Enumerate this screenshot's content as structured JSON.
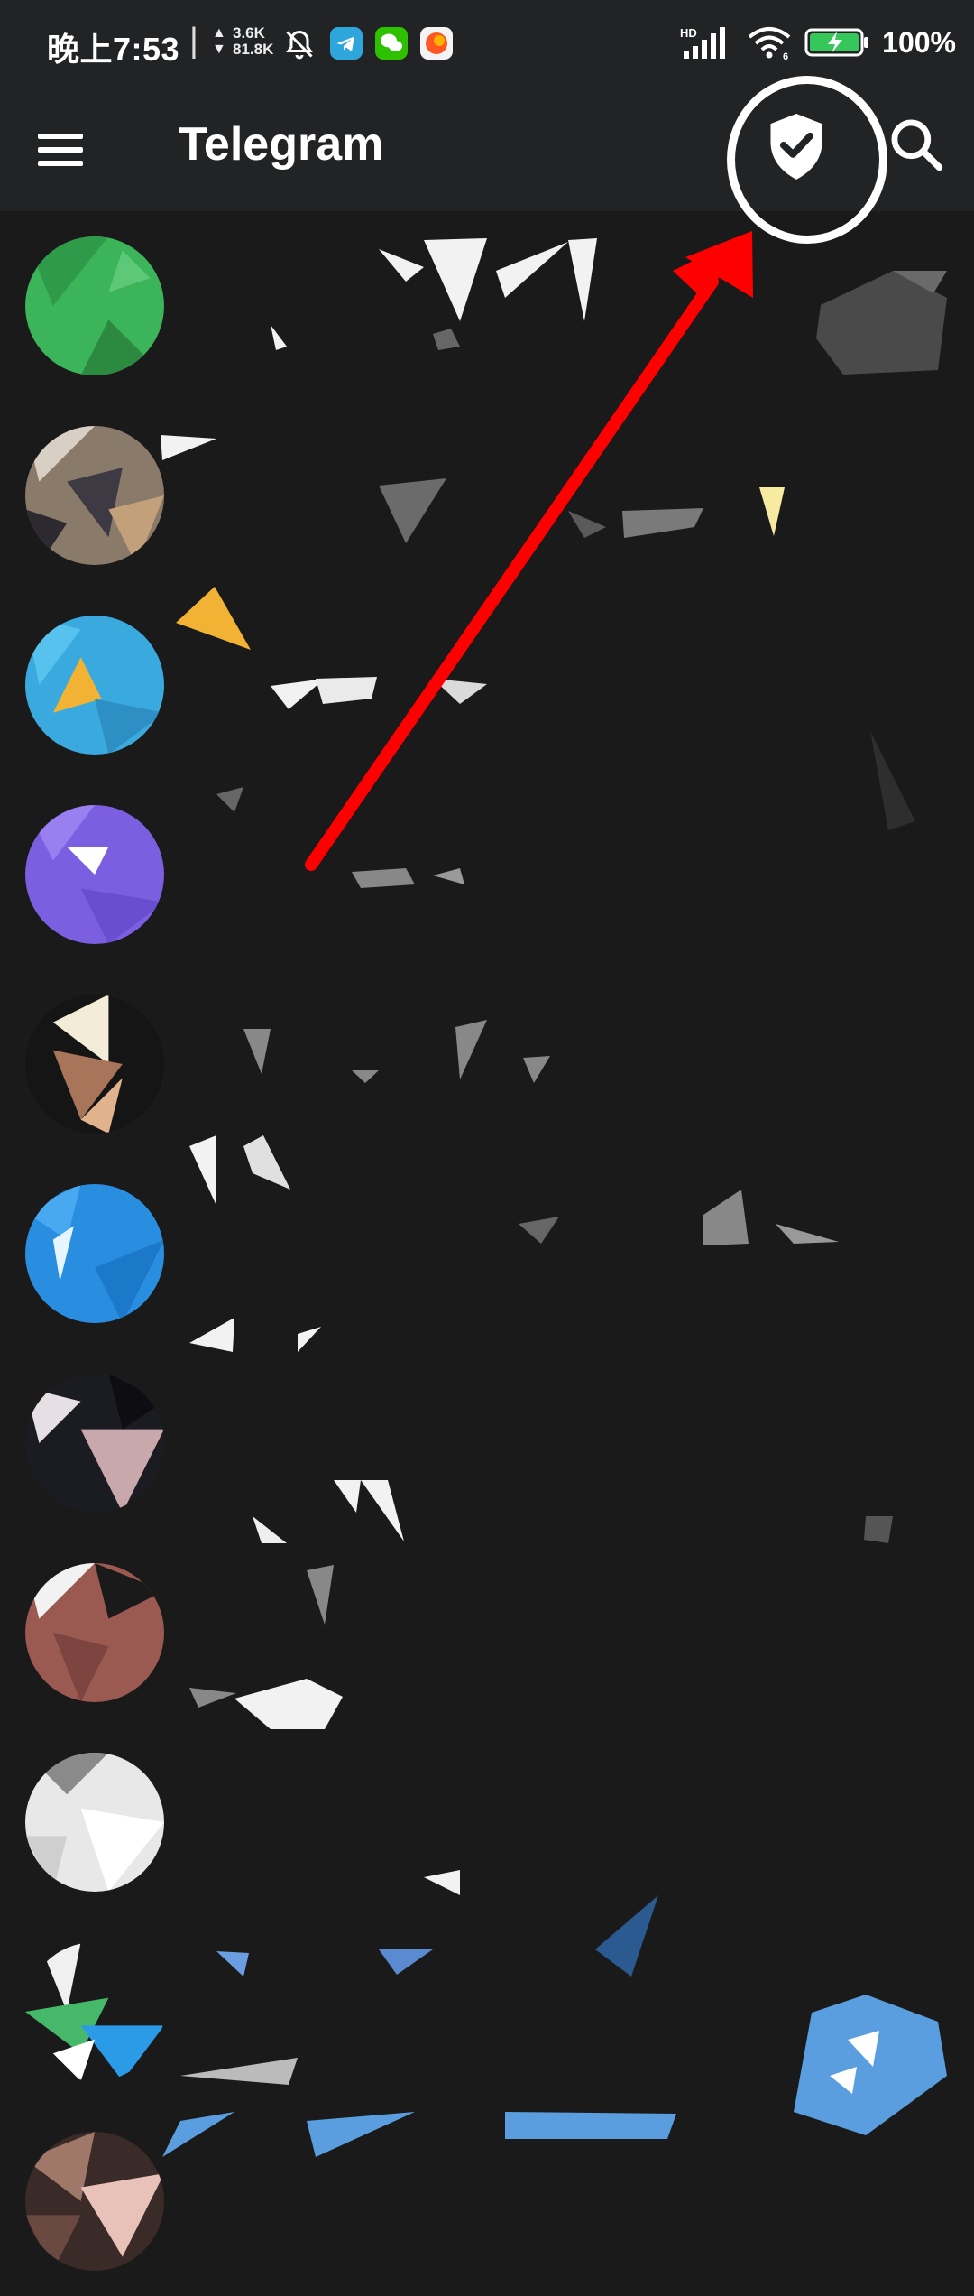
{
  "status_bar": {
    "time": "晚上7:53",
    "separator": "|",
    "upload_speed": "3.6K",
    "download_speed": "81.8K",
    "battery_percent": "100%",
    "hd_label": "HD",
    "wifi_label": "6",
    "icons": [
      "mute-bell-icon",
      "telegram-app-icon",
      "wechat-app-icon",
      "orange-app-icon",
      "signal-icon",
      "wifi-icon",
      "battery-charging-icon"
    ]
  },
  "app_bar": {
    "title": "Telegram",
    "icons": [
      "menu-icon",
      "shield-check-icon",
      "search-icon"
    ]
  },
  "annotation": {
    "arrow_color": "#ff0000",
    "circle_color": "#ffffff"
  },
  "colors": {
    "background": "#1a1a1a",
    "app_bar": "#222325"
  },
  "chats": [
    {
      "avatar": "green-avatar",
      "color": "#3bb45a"
    },
    {
      "avatar": "photo-avatar",
      "color": "#8a7a6a"
    },
    {
      "avatar": "blue-avatar",
      "color": "#3aa9de"
    },
    {
      "avatar": "purple-avatar",
      "color": "#7b5fe0"
    },
    {
      "avatar": "photo-avatar",
      "color": "#a8755a"
    },
    {
      "avatar": "blue-avatar",
      "color": "#2a8ee0"
    },
    {
      "avatar": "photo-avatar",
      "color": "#c7b8bb"
    },
    {
      "avatar": "photo-avatar",
      "color": "#9a5a52"
    },
    {
      "avatar": "photo-avatar",
      "color": "#e8e8e8"
    },
    {
      "avatar": "photo-avatar",
      "color": "#46b86a"
    },
    {
      "avatar": "photo-avatar",
      "color": "#a0786a"
    }
  ]
}
